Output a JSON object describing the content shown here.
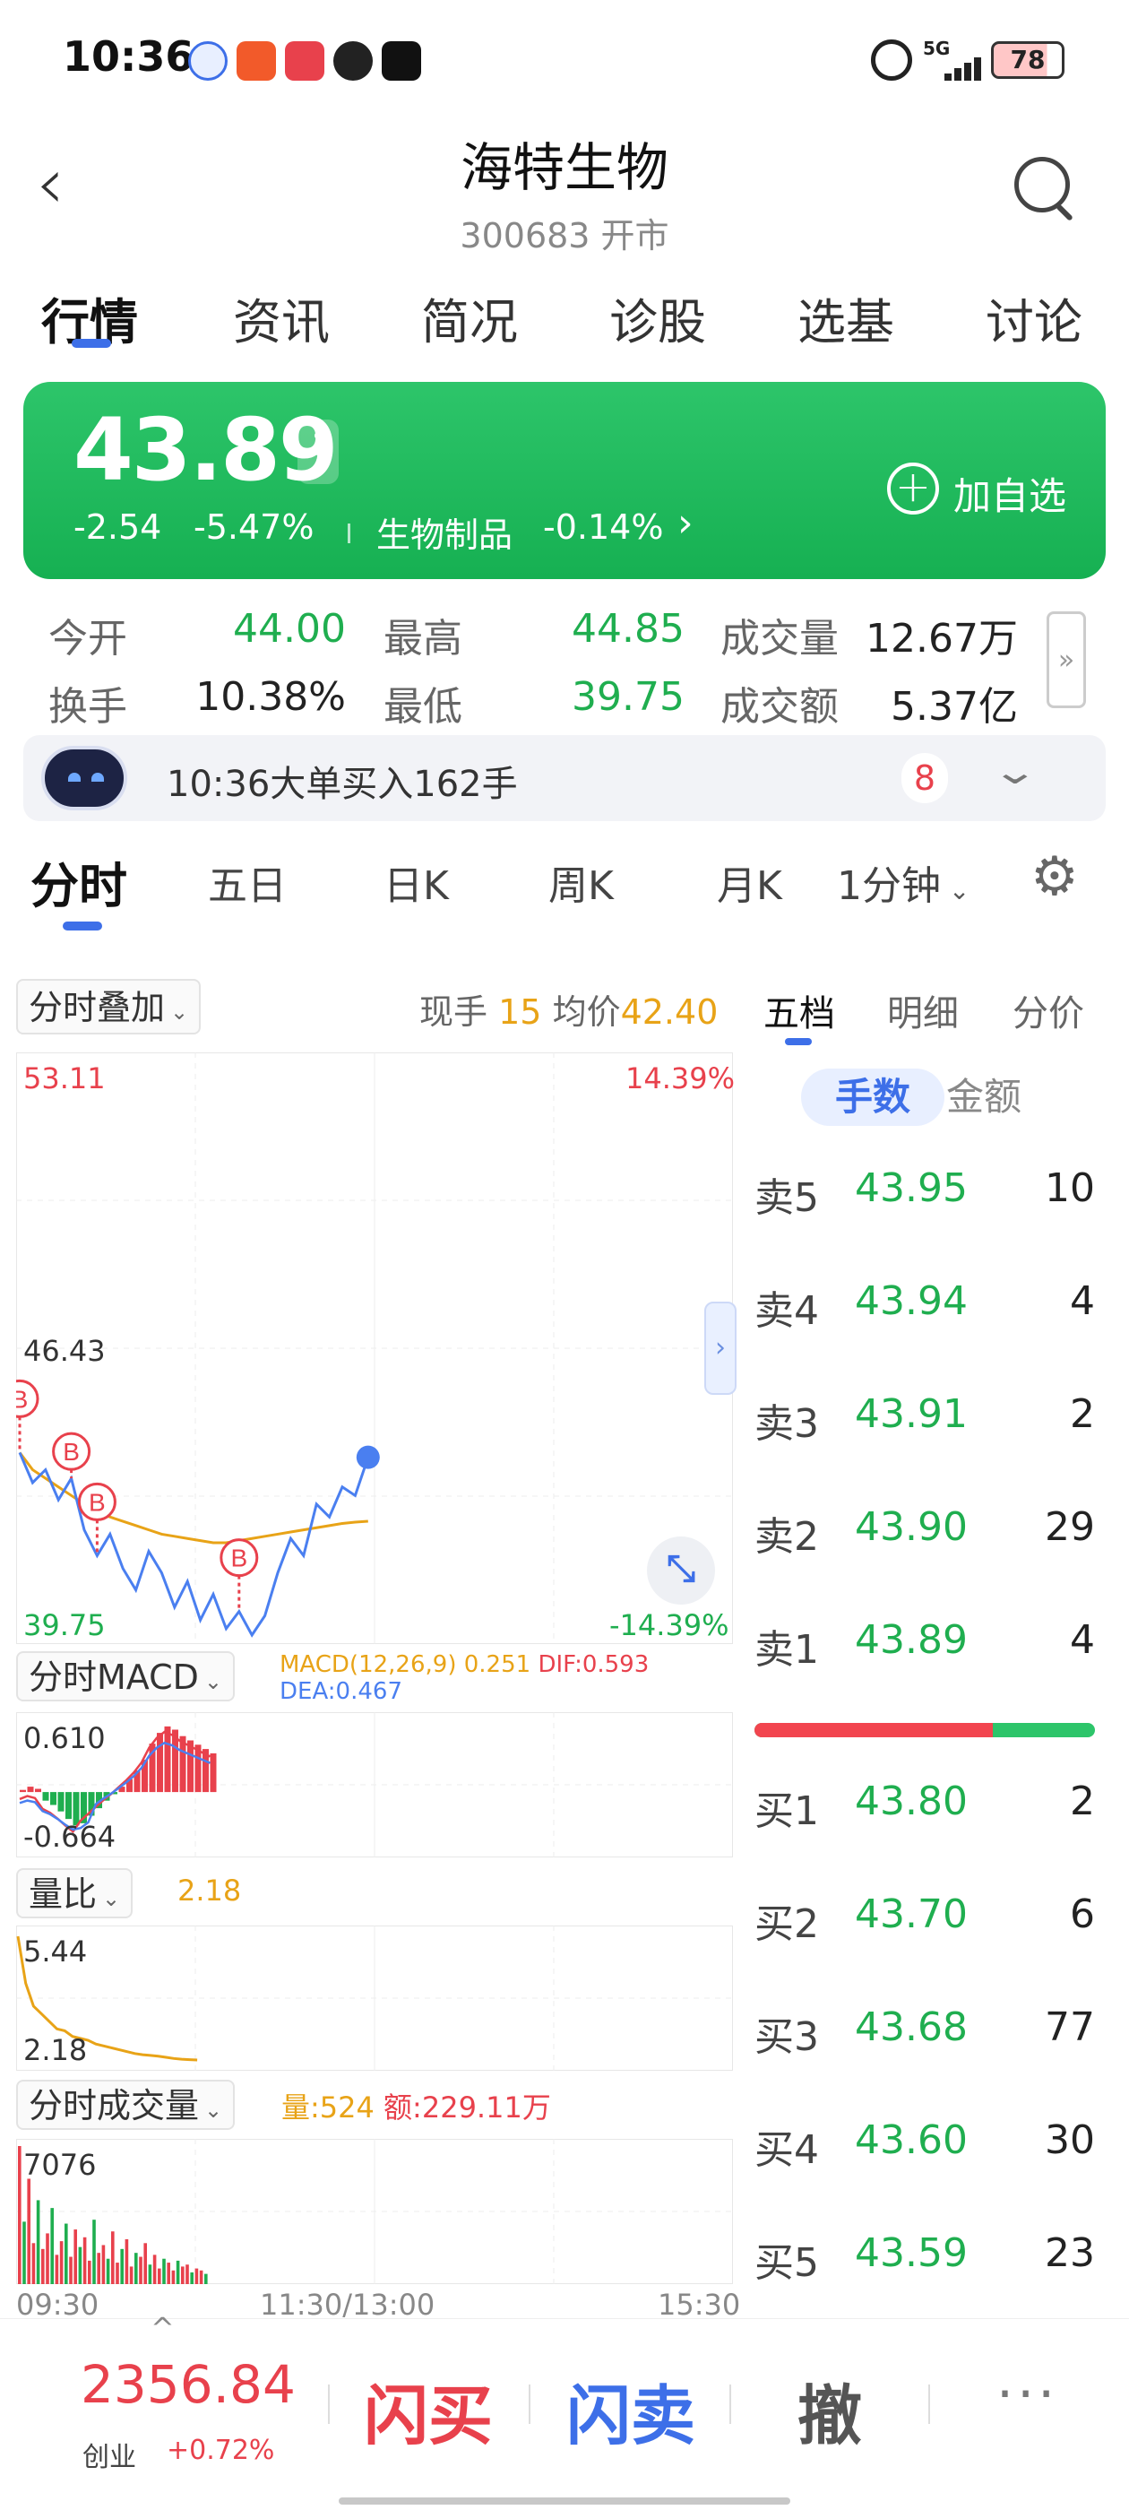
{
  "status_bar": {
    "time": "10:36",
    "network": "5G",
    "battery": "78"
  },
  "header": {
    "name": "海特生物",
    "code_status": "300683 开市"
  },
  "main_tabs": [
    {
      "label": "行情"
    },
    {
      "label": "资讯"
    },
    {
      "label": "简况"
    },
    {
      "label": "诊股"
    },
    {
      "label": "选基"
    },
    {
      "label": "讨论"
    }
  ],
  "price": {
    "current": "43.89",
    "change": "-2.54",
    "change_pct": "-5.47%",
    "sector": "生物制品",
    "sector_pct": "-0.14%",
    "add_watch": "加自选"
  },
  "stats": {
    "open_label": "今开",
    "open": "44.00",
    "high_label": "最高",
    "high": "44.85",
    "volume_label": "成交量",
    "volume": "12.67万",
    "turnover_label": "换手",
    "turnover": "10.38%",
    "low_label": "最低",
    "low": "39.75",
    "amount_label": "成交额",
    "amount": "5.37亿"
  },
  "alert": {
    "text": "10:36大单买入162手",
    "count": "8"
  },
  "period_tabs": [
    {
      "label": "分时"
    },
    {
      "label": "五日"
    },
    {
      "label": "日K"
    },
    {
      "label": "周K"
    },
    {
      "label": "月K"
    },
    {
      "label": "1分钟"
    }
  ],
  "overlay": {
    "label": "分时叠加",
    "live_label": "现手",
    "live_value": "15",
    "avg_label": "均价",
    "avg_value": "42.40"
  },
  "intraday": {
    "y_top": "53.11",
    "y_mid": "46.43",
    "y_bottom": "39.75",
    "pct_top": "14.39%",
    "pct_bottom": "-14.39%",
    "price_series": [
      44.0,
      43.3,
      43.6,
      42.9,
      43.4,
      42.2,
      41.6,
      42.1,
      41.3,
      40.8,
      41.7,
      41.2,
      40.4,
      41.0,
      40.1,
      40.7,
      39.9,
      40.3,
      39.75,
      40.2,
      41.2,
      42.0,
      41.6,
      42.8,
      42.5,
      43.2,
      43.0,
      43.89
    ],
    "avg_series": [
      44.0,
      43.6,
      43.4,
      43.2,
      43.0,
      42.8,
      42.6,
      42.5,
      42.4,
      42.3,
      42.2,
      42.1,
      42.05,
      42.0,
      41.95,
      41.9,
      41.9,
      41.95,
      42.0,
      42.05,
      42.1,
      42.15,
      42.2,
      42.25,
      42.3,
      42.35,
      42.38,
      42.4
    ],
    "buy_markers": [
      "B",
      "B",
      "B",
      "B"
    ],
    "colors": {
      "price": "#4a7ff0",
      "avg": "#e8a317",
      "marker": "#e8414c"
    }
  },
  "macd": {
    "label": "分时MACD",
    "params": "MACD(12,26,9)",
    "macd_val": "0.251",
    "dif_label": "DIF:",
    "dif_val": "0.593",
    "dea_label": "DEA:",
    "dea_val": "0.467",
    "y_top": "0.610",
    "y_bottom": "-0.664",
    "hist": [
      0.02,
      0.05,
      0.03,
      -0.08,
      -0.12,
      -0.18,
      -0.25,
      -0.31,
      -0.29,
      -0.22,
      -0.15,
      -0.08,
      -0.02,
      0.05,
      0.12,
      0.2,
      0.3,
      0.45,
      0.55,
      0.61,
      0.58,
      0.52,
      0.48,
      0.44,
      0.4,
      0.36
    ]
  },
  "volume_ratio": {
    "label": "量比",
    "value": "2.18",
    "y_top": "5.44",
    "y_bottom": "2.18",
    "series": [
      5.44,
      4.2,
      3.6,
      3.4,
      3.2,
      3.0,
      2.95,
      2.8,
      2.75,
      2.7,
      2.6,
      2.55,
      2.5,
      2.45,
      2.4,
      2.35,
      2.32,
      2.3,
      2.28,
      2.25,
      2.22,
      2.2,
      2.19,
      2.18
    ]
  },
  "volume": {
    "label": "分时成交量",
    "vol_label": "量:",
    "vol_value": "524",
    "amt_label": "额:",
    "amt_value": "229.11万",
    "y_top": "7076",
    "bars": [
      7076,
      3200,
      5400,
      2100,
      4300,
      1800,
      2600,
      3900,
      1500,
      2200,
      3100,
      1400,
      2800,
      1900,
      2400,
      1200,
      3300,
      1600,
      2000,
      1300,
      2700,
      1100,
      1800,
      2300,
      900,
      1600,
      1400,
      2100,
      1000,
      1500,
      800,
      1300,
      1100,
      700,
      1200,
      900,
      1000,
      600,
      800,
      700,
      524
    ],
    "times": [
      "09:30",
      "11:30/13:00",
      "15:30"
    ]
  },
  "order_book": {
    "tabs": [
      {
        "label": "五档"
      },
      {
        "label": "明细"
      },
      {
        "label": "分价"
      }
    ],
    "mode_active": "手数",
    "mode_other": "金额",
    "asks": [
      {
        "label": "卖5",
        "price": "43.95",
        "vol": "10"
      },
      {
        "label": "卖4",
        "price": "43.94",
        "vol": "4"
      },
      {
        "label": "卖3",
        "price": "43.91",
        "vol": "2"
      },
      {
        "label": "卖2",
        "price": "43.90",
        "vol": "29"
      },
      {
        "label": "卖1",
        "price": "43.89",
        "vol": "4"
      }
    ],
    "bids": [
      {
        "label": "买1",
        "price": "43.80",
        "vol": "2"
      },
      {
        "label": "买2",
        "price": "43.70",
        "vol": "6"
      },
      {
        "label": "买3",
        "price": "43.68",
        "vol": "77"
      },
      {
        "label": "买4",
        "price": "43.60",
        "vol": "30"
      },
      {
        "label": "买5",
        "price": "43.59",
        "vol": "23"
      }
    ],
    "buy_ratio": 0.7
  },
  "bottom": {
    "index_value": "2356.84",
    "index_name": "创业",
    "index_pct": "+0.72%",
    "flash_buy": "闪买",
    "flash_sell": "闪卖",
    "cancel": "撤",
    "more": "···"
  }
}
